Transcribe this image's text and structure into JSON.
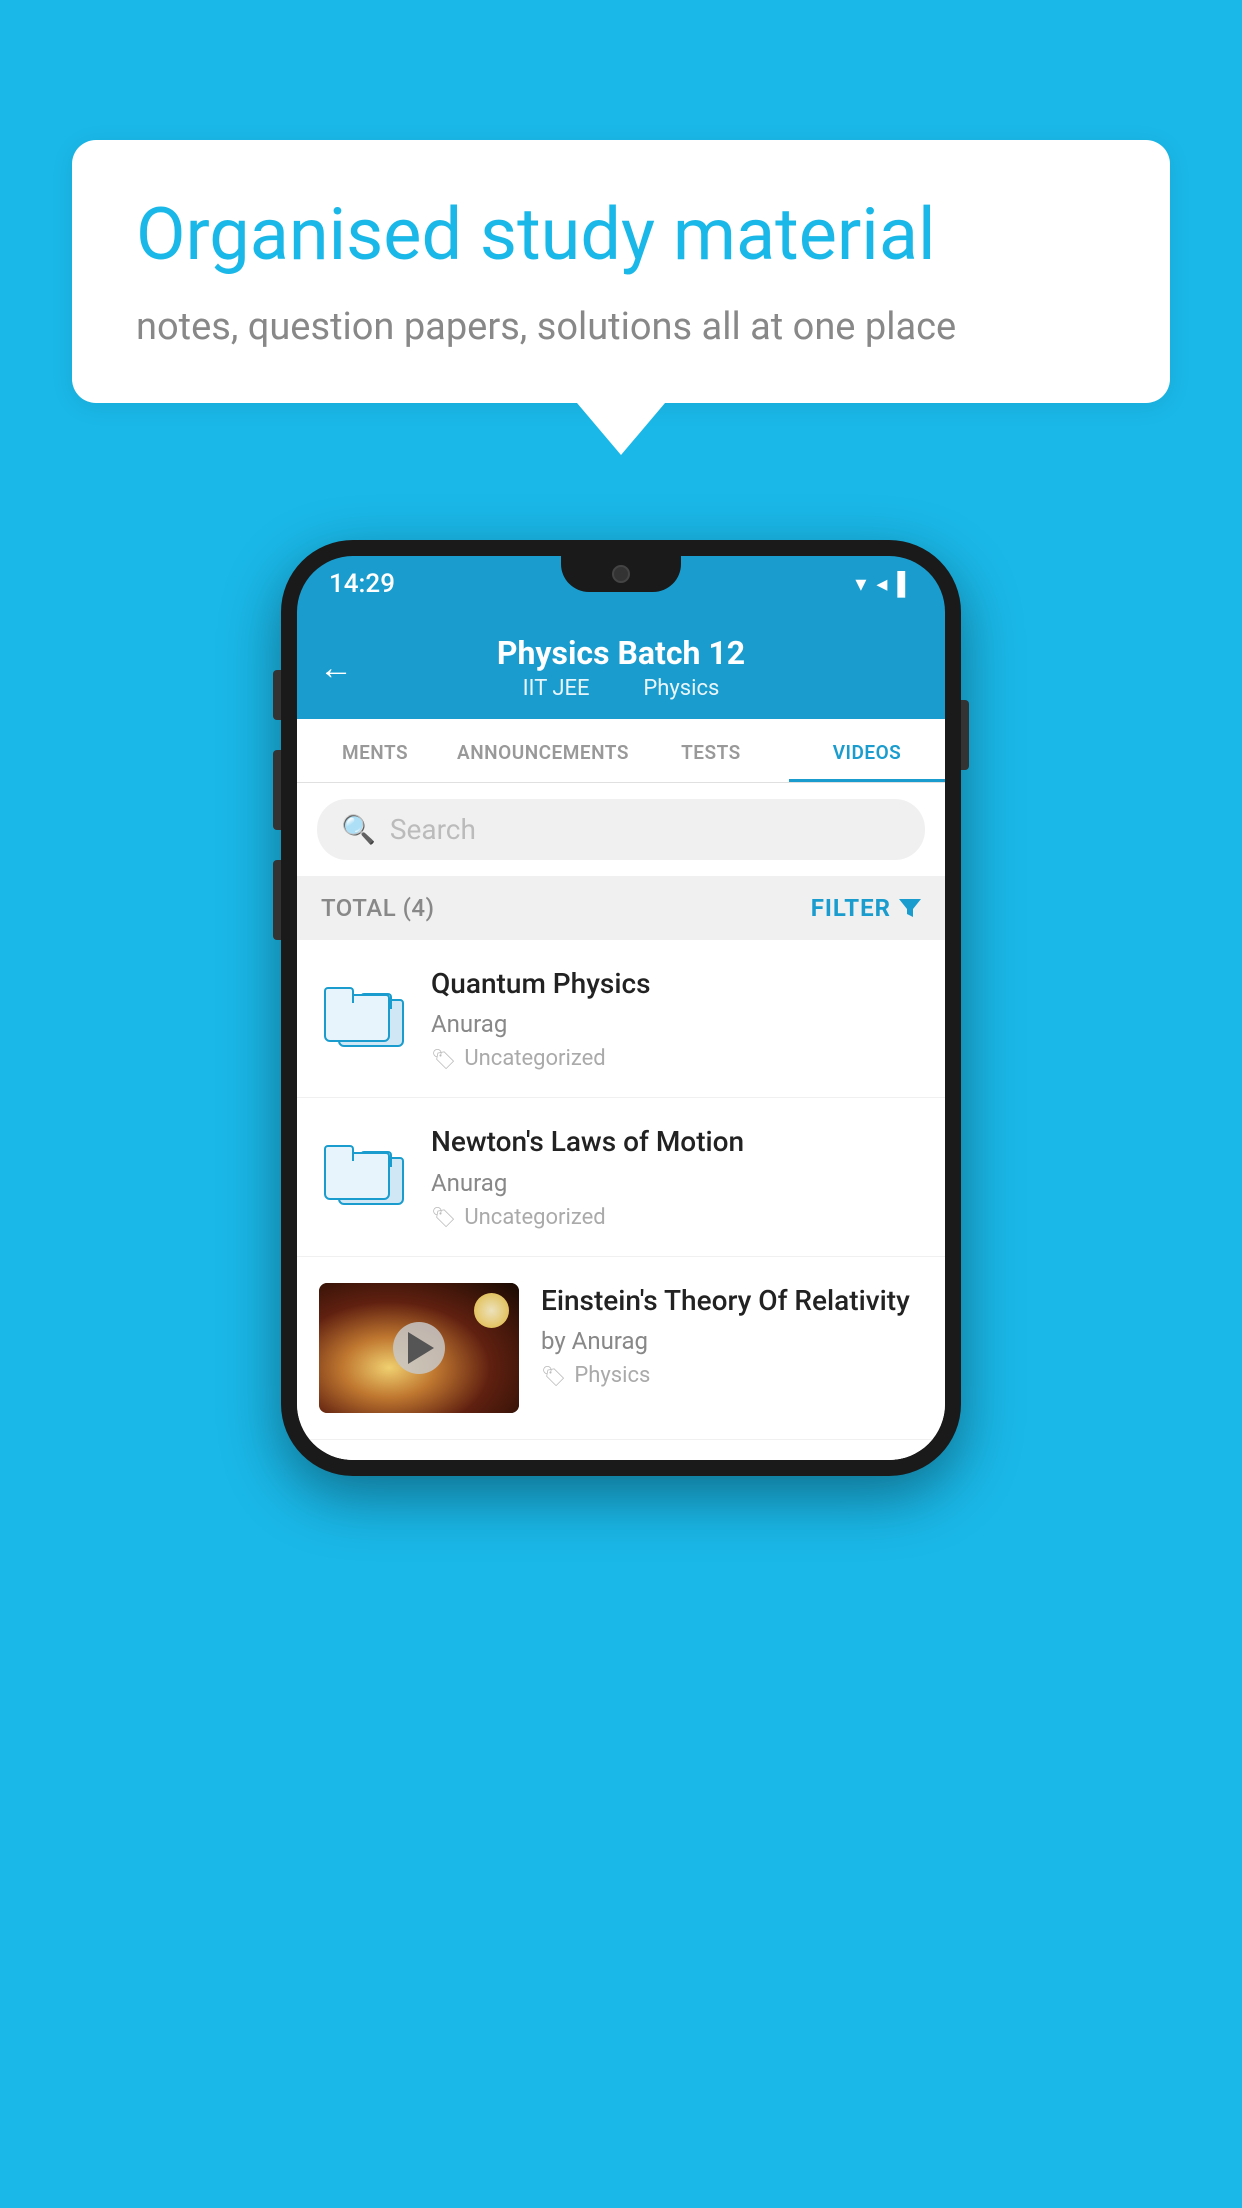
{
  "background_color": "#1ab8e8",
  "speech_bubble": {
    "title": "Organised study material",
    "subtitle": "notes, question papers, solutions all at one place"
  },
  "status_bar": {
    "time": "14:29",
    "icons": "▾◂▌"
  },
  "app_header": {
    "back_label": "←",
    "title": "Physics Batch 12",
    "subtitle_part1": "IIT JEE",
    "subtitle_part2": "Physics"
  },
  "tabs": [
    {
      "label": "MENTS",
      "active": false
    },
    {
      "label": "ANNOUNCEMENTS",
      "active": false
    },
    {
      "label": "TESTS",
      "active": false
    },
    {
      "label": "VIDEOS",
      "active": true
    }
  ],
  "search": {
    "placeholder": "Search"
  },
  "filter_bar": {
    "total_label": "TOTAL (4)",
    "filter_label": "FILTER"
  },
  "videos": [
    {
      "title": "Quantum Physics",
      "author": "Anurag",
      "tag": "Uncategorized",
      "has_thumb": false
    },
    {
      "title": "Newton's Laws of Motion",
      "author": "Anurag",
      "tag": "Uncategorized",
      "has_thumb": false
    },
    {
      "title": "Einstein's Theory Of Relativity",
      "author": "by Anurag",
      "tag": "Physics",
      "has_thumb": true
    }
  ]
}
